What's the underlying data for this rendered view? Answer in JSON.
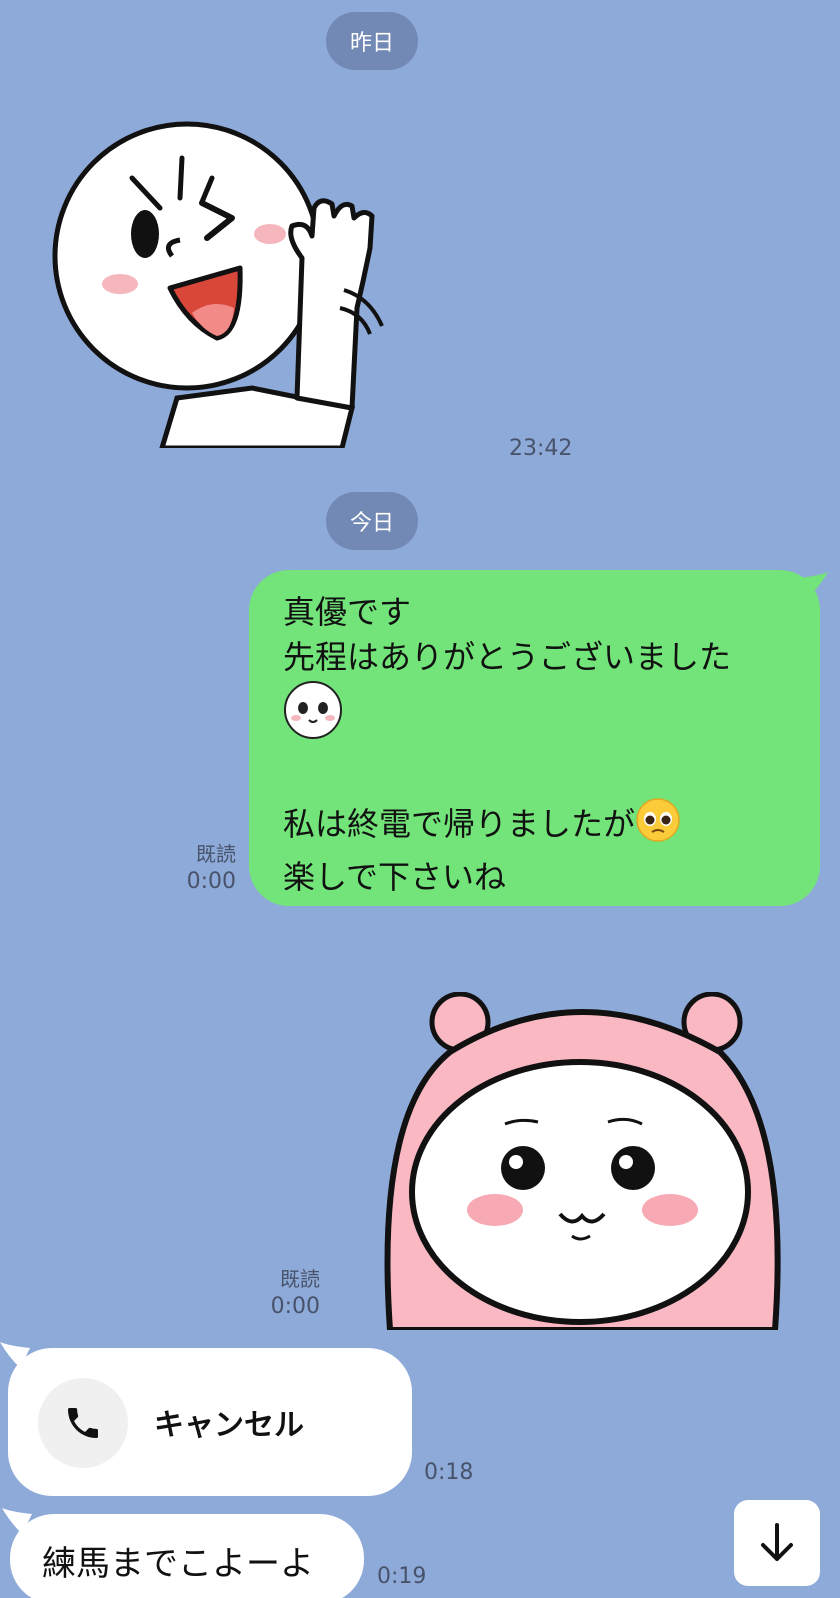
{
  "dates": {
    "yesterday": "昨日",
    "today": "今日"
  },
  "messages": {
    "sticker1_time": "23:42",
    "green_line1": "真優です",
    "green_line2": "先程はありがとうございました",
    "green_line4": "私は終電で帰りましたが",
    "green_line5": "楽しで下さいね",
    "green_read": "既読",
    "green_time": "0:00",
    "sticker2_read": "既読",
    "sticker2_time": "0:00",
    "call_label": "キャンセル",
    "call_time": "0:18",
    "last_text": "練馬までこよーよ",
    "last_time": "0:19"
  },
  "colors": {
    "background": "#8eaad9",
    "sent_bubble": "#72e479",
    "date_pill": "#7288b5"
  },
  "icons": {
    "phone": "phone-icon",
    "scroll": "arrow-down-icon",
    "emoji_smile": "moon-face-emoji",
    "emoji_pleading": "pleading-face-emoji"
  }
}
